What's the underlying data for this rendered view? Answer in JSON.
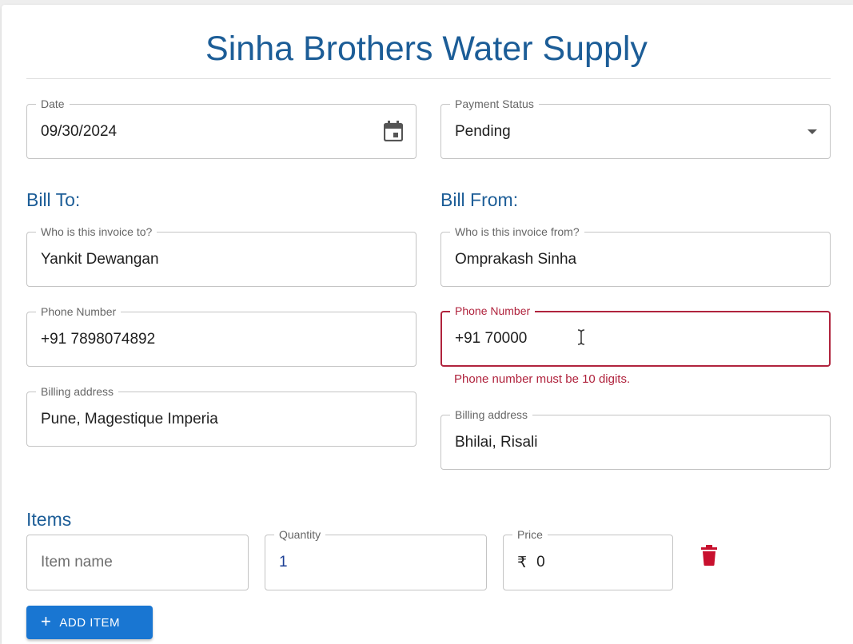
{
  "app": {
    "title": "Sinha Brothers Water Supply"
  },
  "date": {
    "label": "Date",
    "value": "09/30/2024"
  },
  "payment_status": {
    "label": "Payment Status",
    "value": "Pending"
  },
  "bill_to": {
    "heading": "Bill To:",
    "name": {
      "label": "Who is this invoice to?",
      "value": "Yankit Dewangan"
    },
    "phone": {
      "label": "Phone Number",
      "value": "+91 7898074892"
    },
    "address": {
      "label": "Billing address",
      "value": "Pune, Magestique Imperia"
    }
  },
  "bill_from": {
    "heading": "Bill From:",
    "name": {
      "label": "Who is this invoice from?",
      "value": "Omprakash Sinha"
    },
    "phone": {
      "label": "Phone Number",
      "value": "+91 70000",
      "error": "Phone number must be 10 digits."
    },
    "address": {
      "label": "Billing address",
      "value": "Bhilai, Risali"
    }
  },
  "items": {
    "heading": "Items",
    "rows": [
      {
        "item_name": {
          "placeholder": "Item name",
          "value": ""
        },
        "quantity": {
          "label": "Quantity",
          "value": "1"
        },
        "price": {
          "label": "Price",
          "currency": "₹",
          "value": "0"
        }
      }
    ],
    "add_button_label": "ADD ITEM"
  },
  "colors": {
    "accent": "#1c5d97",
    "error": "#b0233d",
    "button": "#1976d2",
    "delete_icon": "#c8102e"
  },
  "icons": [
    "calendar-icon",
    "dropdown-caret-icon",
    "text-cursor-icon",
    "delete-icon",
    "plus-icon"
  ]
}
